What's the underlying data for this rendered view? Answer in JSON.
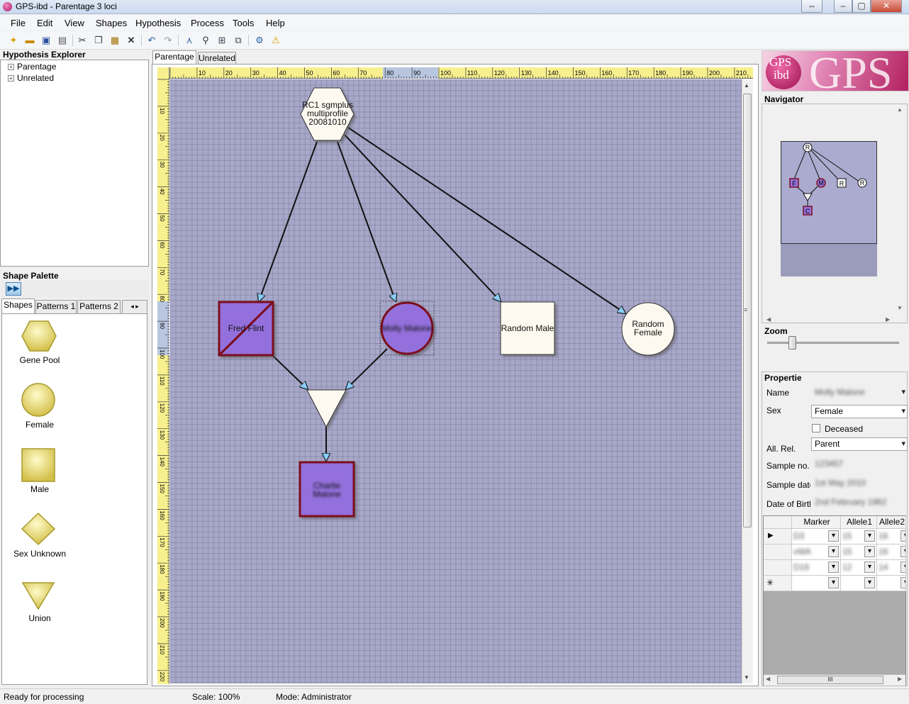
{
  "window": {
    "title": "GPS-ibd - Parentage 3 loci"
  },
  "menu": [
    "File",
    "Edit",
    "View",
    "Shapes",
    "Hypothesis",
    "Process",
    "Tools",
    "Help"
  ],
  "explorer": {
    "title": "Hypothesis Explorer",
    "items": [
      "Parentage",
      "Unrelated"
    ]
  },
  "palette": {
    "title": "Shape Palette",
    "tabs": [
      "Shapes",
      "Patterns 1",
      "Patterns 2"
    ],
    "shapes": [
      "Gene Pool",
      "Female",
      "Male",
      "Sex Unknown",
      "Union"
    ]
  },
  "document": {
    "tabs": [
      "Parentage",
      "Unrelated"
    ],
    "ruler_top": [
      "10",
      "20",
      "30",
      "40",
      "50",
      "60",
      "70",
      "80",
      "90",
      "100",
      "110",
      "120",
      "130",
      "140",
      "150",
      "160",
      "170",
      "180",
      "190",
      "200",
      "210"
    ],
    "ruler_left": [
      "10",
      "20",
      "30",
      "40",
      "50",
      "60",
      "70",
      "80",
      "90",
      "100",
      "110",
      "120",
      "130",
      "140",
      "150",
      "160",
      "170",
      "180",
      "190",
      "200",
      "210",
      "220"
    ],
    "nodes": {
      "gene_pool": [
        "RC1 sgmplus",
        "multiprofile",
        "20081010"
      ],
      "father": "Fred Flint",
      "mother": "Molly Malone",
      "random_male": "Random Male",
      "random_female": [
        "Random",
        "Female"
      ],
      "child": [
        "Charlie",
        "Malone"
      ]
    },
    "colors": {
      "canvas": "#a7a7c9",
      "person_fill": "#9370db",
      "person_border": "#7b0f1e",
      "node_fill": "#fdf9f0",
      "arrow_head": "#87cefa"
    }
  },
  "navigator": {
    "title": "Navigator",
    "zoom_label": "Zoom",
    "node_letters": [
      "R",
      "F",
      "M",
      "R",
      "R",
      "C"
    ]
  },
  "properties": {
    "title": "Properties",
    "name_label": "Name",
    "name_value": "Molly Malone",
    "sex_label": "Sex",
    "sex_value": "Female",
    "deceased_label": "Deceased",
    "allrel_label": "All. Rel.",
    "allrel_value": "Parent",
    "sample_no_label": "Sample no.",
    "sample_no_value": "123457",
    "sample_date_label": "Sample date",
    "sample_date_value": "1st May 2010",
    "dob_label": "Date of Birth",
    "dob_value": "2nd February 1962"
  },
  "markers": {
    "headers": [
      "Marker",
      "Allele1",
      "Allele2"
    ],
    "rows": [
      [
        "D3",
        "15",
        "16"
      ],
      [
        "vWA",
        "15",
        "16"
      ],
      [
        "D16",
        "12",
        "14"
      ]
    ],
    "new_row_symbol": "✳",
    "current_row_symbol": "▶",
    "hscroll_grip": "III"
  },
  "status": {
    "ready": "Ready for processing",
    "scale": "Scale: 100%",
    "mode": "Mode: Administrator"
  }
}
